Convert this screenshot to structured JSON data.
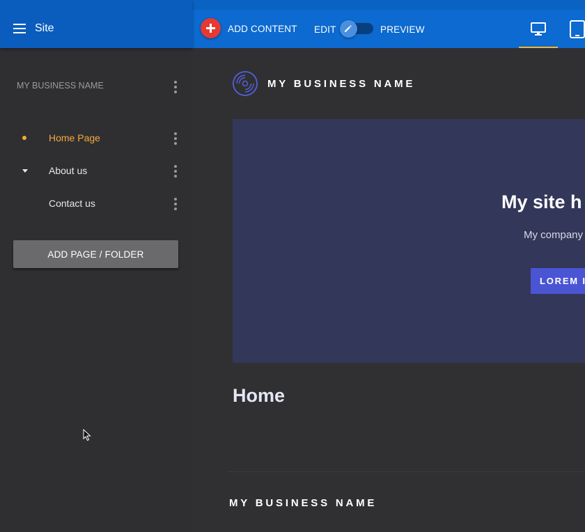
{
  "app": {
    "site_title": "Site"
  },
  "toolbar": {
    "add_content_label": "ADD CONTENT",
    "edit_label": "EDIT",
    "preview_label": "PREVIEW",
    "mode": "edit",
    "devices": [
      {
        "name": "desktop",
        "active": true
      },
      {
        "name": "tablet",
        "active": false
      }
    ]
  },
  "sidebar": {
    "business_name": "MY BUSINESS NAME",
    "pages": [
      {
        "label": "Home Page",
        "current": true
      },
      {
        "label": "About us",
        "current": false,
        "expandable": true
      },
      {
        "label": "Contact us",
        "current": false
      }
    ],
    "add_page_label": "ADD PAGE / FOLDER"
  },
  "preview": {
    "brand_name": "MY BUSINESS NAME",
    "hero": {
      "title": "My site h",
      "subtitle": "My company",
      "button_label": "LOREM I"
    },
    "page_heading": "Home",
    "footer_brand": "MY BUSINESS NAME"
  },
  "colors": {
    "topbar": "#0a63c2",
    "accent": "#f4aa3c",
    "add_button": "#e53935",
    "hero_bg": "#333759",
    "hero_button": "#4a55d3",
    "sidebar_bg": "#2f2f32"
  }
}
